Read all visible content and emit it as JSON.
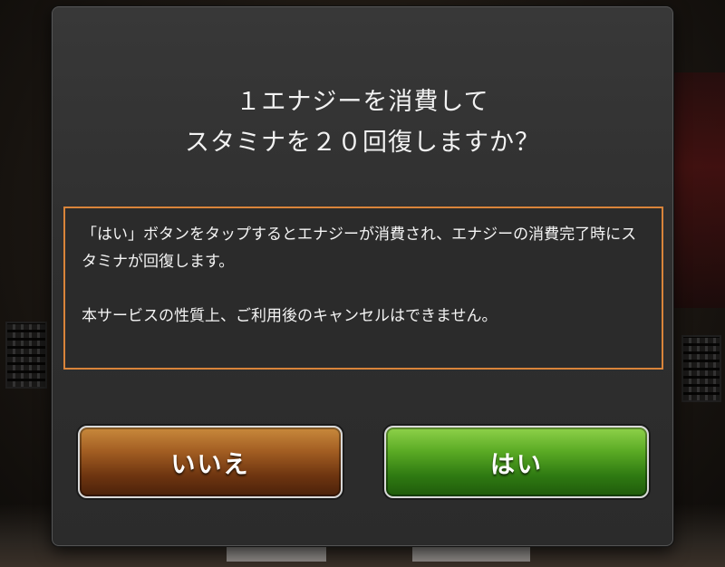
{
  "dialog": {
    "title_line1": "１エナジーを消費して",
    "title_line2": "スタミナを２０回復しますか？",
    "notice_paragraph1": "「はい」ボタンをタップするとエナジーが消費され、エナジーの消費完了時にスタミナが回復します。",
    "notice_paragraph2": "本サービスの性質上、ご利用後のキャンセルはできません。",
    "cancel_label": "いいえ",
    "confirm_label": "はい"
  },
  "colors": {
    "notice_border": "#d9843a",
    "cancel_button": "#8a4a18",
    "confirm_button": "#4a9a1e"
  }
}
